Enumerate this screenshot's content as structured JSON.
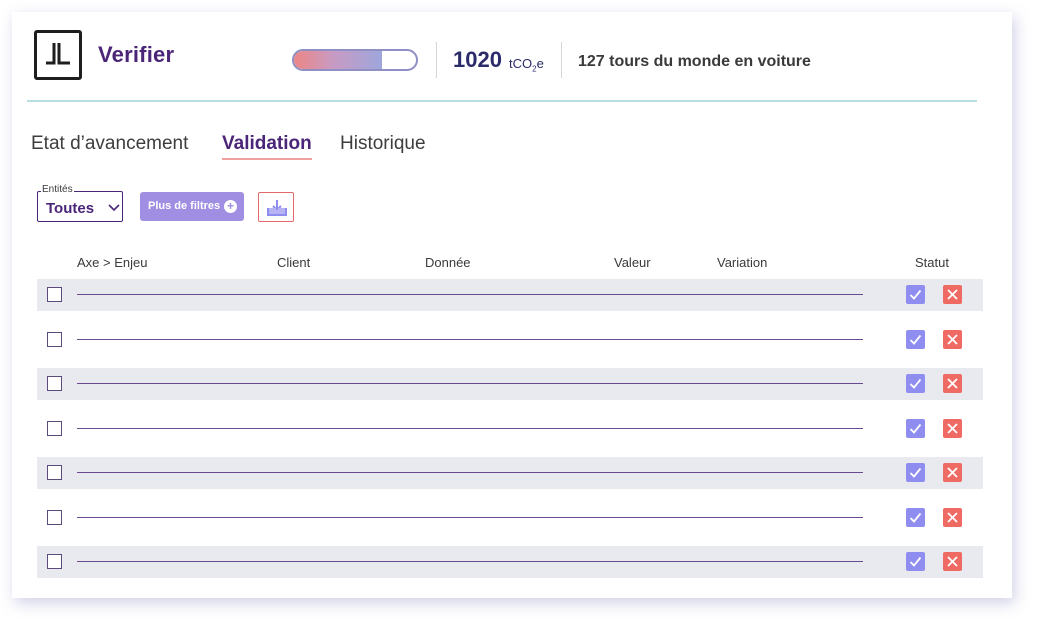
{
  "header": {
    "app_title": "Verifier",
    "progress_fraction": 0.72,
    "co2_value": "1020",
    "co2_unit": "tCO",
    "co2_unit_sub": "2",
    "co2_unit_suffix": "e",
    "equivalence_text": "127 tours du monde en voiture"
  },
  "tabs": [
    {
      "label": "Etat d’avancement",
      "active": false
    },
    {
      "label": "Validation",
      "active": true
    },
    {
      "label": "Historique",
      "active": false
    }
  ],
  "filters": {
    "entity_legend": "Entités",
    "entity_value": "Toutes",
    "more_filters_label": "Plus de filtres",
    "more_filters_icon": "plus-circle-icon",
    "download_icon": "download-icon"
  },
  "table": {
    "columns": [
      "Axe > Enjeu",
      "Client",
      "Donnée",
      "Valeur",
      "Variation",
      "Statut"
    ],
    "row_count": 7
  },
  "colors": {
    "brand_purple": "#4a2578",
    "approve": "#8f8df0",
    "reject": "#f06a64",
    "row_shade": "#e9eaef",
    "divider_teal": "#b8dfe0"
  }
}
